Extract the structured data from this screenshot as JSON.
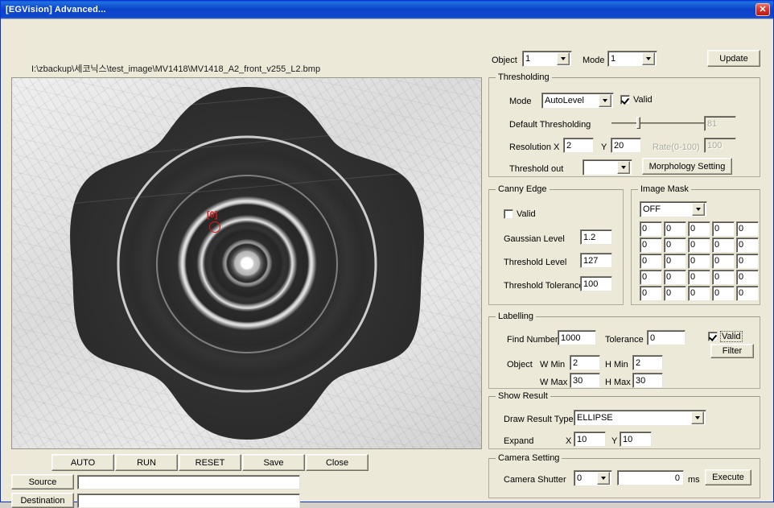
{
  "window": {
    "title": "[EGVision] Advanced...",
    "close_label": "✕",
    "titlebar_color": "#0b43c8",
    "face_color": "#ece9d8"
  },
  "image_view": {
    "path": "I:\\zbackup\\세코닉스\\test_image\\MV1418\\MV1418_A2_front_v255_L2.bmp",
    "marker_label": "[0]",
    "marker_color": "#e01818"
  },
  "top_controls": {
    "object_label": "Object",
    "object_value": "1",
    "mode_label": "Mode",
    "mode_value": "1",
    "update_label": "Update"
  },
  "thresholding": {
    "title": "Thresholding",
    "mode_label": "Mode",
    "mode_value": "AutoLevel",
    "valid_label": "Valid",
    "valid_checked": true,
    "default_thresholding_label": "Default Thresholding",
    "default_thresholding_value": "81",
    "slider_percent": 25,
    "resolution_x_label": "Resolution X",
    "resolution_x_value": "2",
    "resolution_y_label": "Y",
    "resolution_y_value": "20",
    "rate_label": "Rate(0-100)",
    "rate_value": "100",
    "rate_disabled": true,
    "threshold_out_label": "Threshold out",
    "threshold_out_value": "",
    "morphology_label": "Morphology Setting"
  },
  "canny_edge": {
    "title": "Canny Edge",
    "valid_label": "Valid",
    "valid_checked": false,
    "gaussian_level_label": "Gaussian Level",
    "gaussian_level_value": "1.2",
    "threshold_level_label": "Threshold Level",
    "threshold_level_value": "127",
    "threshold_tolerance_label": "Threshold Tolerance",
    "threshold_tolerance_value": "100"
  },
  "image_mask": {
    "title": "Image Mask",
    "mode_value": "OFF",
    "grid": [
      [
        "0",
        "0",
        "0",
        "0",
        "0"
      ],
      [
        "0",
        "0",
        "0",
        "0",
        "0"
      ],
      [
        "0",
        "0",
        "0",
        "0",
        "0"
      ],
      [
        "0",
        "0",
        "0",
        "0",
        "0"
      ],
      [
        "0",
        "0",
        "0",
        "0",
        "0"
      ]
    ]
  },
  "labelling": {
    "title": "Labelling",
    "find_number_label": "Find Number",
    "find_number_value": "1000",
    "tolerance_label": "Tolerance",
    "tolerance_value": "0",
    "object_label": "Object",
    "w_min_label": "W Min",
    "w_min_value": "2",
    "h_min_label": "H Min",
    "h_min_value": "2",
    "w_max_label": "W Max",
    "w_max_value": "30",
    "h_max_label": "H Max",
    "h_max_value": "30",
    "valid_label": "Valid",
    "valid_checked": true,
    "filter_label": "Filter"
  },
  "show_result": {
    "title": "Show Result",
    "draw_result_type_label": "Draw Result Type",
    "draw_result_type_value": "ELLIPSE",
    "expand_label": "Expand",
    "expand_x_label": "X",
    "expand_x_value": "10",
    "expand_y_label": "Y",
    "expand_y_value": "10"
  },
  "camera_setting": {
    "title": "Camera Setting",
    "shutter_label": "Camera Shutter",
    "shutter_mode_value": "0",
    "shutter_ms_value": "0",
    "ms_label": "ms",
    "execute_label": "Execute"
  },
  "bottom_bar": {
    "buttons": [
      {
        "label": "AUTO"
      },
      {
        "label": "RUN"
      },
      {
        "label": "RESET"
      },
      {
        "label": "Save"
      },
      {
        "label": "Close"
      }
    ],
    "source_label": "Source",
    "source_value": "",
    "destination_label": "Destination",
    "destination_value": ""
  }
}
